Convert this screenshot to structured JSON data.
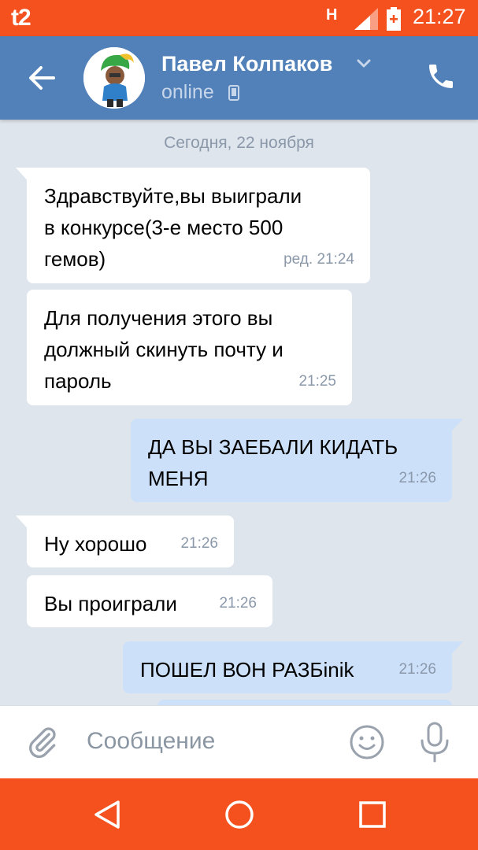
{
  "status_bar": {
    "carrier": "t2",
    "network": "H",
    "time": "21:27"
  },
  "header": {
    "contact_name": "Павел Колпаков",
    "presence": "online",
    "accent": "#5181b8"
  },
  "chat": {
    "date_separator": "Сегодня, 22 ноября",
    "messages": [
      {
        "direction": "in",
        "text": "Здравствуйте,вы выиграли\nв конкурсе(3-е место 500\nгемов)",
        "time": "ред. 21:24"
      },
      {
        "direction": "in",
        "text": "Для получения этого вы\nдолжный скинуть почту и\nпароль",
        "time": "21:25"
      },
      {
        "direction": "out",
        "text": "ДА ВЫ ЗАЕБАЛИ КИДАТЬ\nМЕНЯ",
        "time": "21:26"
      },
      {
        "direction": "in",
        "text": "Ну хорошо",
        "time": "21:26"
      },
      {
        "direction": "in",
        "text": "Вы проиграли",
        "time": "21:26"
      },
      {
        "direction": "out",
        "text": "ПОШЕЛ ВОН РАЗБinik",
        "time": "21:26"
      }
    ]
  },
  "input": {
    "placeholder": "Сообщение"
  },
  "icons": {
    "back": "arrow-left-icon",
    "dropdown": "chevron-down-icon",
    "call": "phone-icon",
    "attach": "paperclip-icon",
    "emoji": "smiley-icon",
    "voice": "microphone-icon"
  },
  "colors": {
    "status_bar": "#f4511e",
    "incoming_bubble": "#ffffff",
    "outgoing_bubble": "#cce0fa",
    "chat_background": "#dfe5ec"
  }
}
